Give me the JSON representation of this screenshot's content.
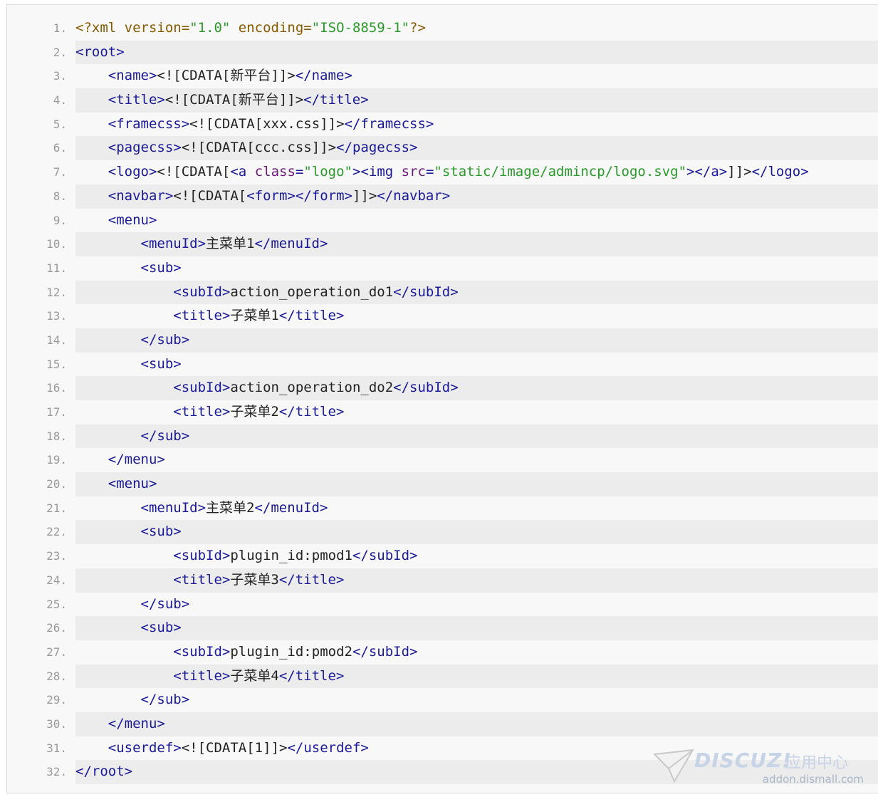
{
  "lines": [
    "<?xml version=\"1.0\" encoding=\"ISO-8859-1\"?>",
    "<root>",
    "    <name><![CDATA[新平台]]></name>",
    "    <title><![CDATA[新平台]]></title>",
    "    <framecss><![CDATA[xxx.css]]></framecss>",
    "    <pagecss><![CDATA[ccc.css]]></pagecss>",
    "    <logo><![CDATA[<a class=\"logo\"><img src=\"static/image/admincp/logo.svg\"></a>]]></logo>",
    "    <navbar><![CDATA[<form></form>]]></navbar>",
    "    <menu>",
    "        <menuId>主菜单1</menuId>",
    "        <sub>",
    "            <subId>action_operation_do1</subId>",
    "            <title>子菜单1</title>",
    "        </sub>",
    "        <sub>",
    "            <subId>action_operation_do2</subId>",
    "            <title>子菜单2</title>",
    "        </sub>",
    "    </menu>",
    "    <menu>",
    "        <menuId>主菜单2</menuId>",
    "        <sub>",
    "            <subId>plugin_id:pmod1</subId>",
    "            <title>子菜单3</title>",
    "        </sub>",
    "        <sub>",
    "            <subId>plugin_id:pmod2</subId>",
    "            <title>子菜单4</title>",
    "        </sub>",
    "    </menu>",
    "    <userdef><![CDATA[1]]></userdef>",
    "</root>"
  ],
  "watermark": {
    "brand": "DISCUZ!",
    "cn": "应用中心",
    "url": "addon.dismall.com"
  },
  "colors": {
    "tag": "#1a1a99",
    "attribute": "#6d1b7b",
    "string": "#2a9a2a",
    "line_number": "#9a9a9a",
    "stripe": "#ececec"
  }
}
